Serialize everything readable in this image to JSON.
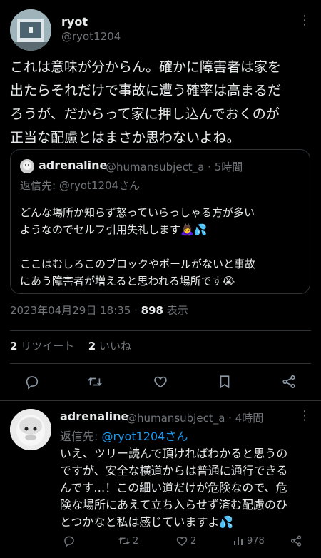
{
  "main_post": {
    "display_name": "ryot",
    "handle": "@ryot1204",
    "body_lines": [
      "これは意味が分からん。確かに障害者は家を",
      "出たらそれだけで事故に遭う確率は高まるだ",
      "ろうが、だからって家に押し込んでおくのが",
      "正当な配慮とはまさか思わないよね。"
    ],
    "quoted": {
      "display_name": "adrenaline",
      "handle_time": "@humansubject_a · 5時間",
      "reply_to": "返信先: @ryot1204さん",
      "body_lines": [
        "どんな場所か知らず怒っていらっしゃる方が多い",
        "ようなのでセルフ引用失礼します🙇‍♀️💦",
        "",
        "ここはむしろこのブロックやポールがないと事故",
        "にあう障害者が増えると思われる場所です😭"
      ]
    },
    "timestamp": "2023年04月29日 18:35 · ",
    "views_count": "898",
    "views_label": " 表示",
    "retweets_count": "2",
    "retweets_label": "リツイート",
    "likes_count": "2",
    "likes_label": "いいね"
  },
  "action_bar": {
    "icons": [
      "reply-icon",
      "retweet-icon",
      "like-icon",
      "bookmark-icon",
      "share-icon"
    ]
  },
  "reply": {
    "display_name": "adrenaline",
    "handle_time": "@humansubject_a · 4時間",
    "reply_prefix": "返信先: ",
    "reply_user": "@ryot1204さん",
    "body_lines": [
      "いえ、ツリー読んで頂ければわかると思うの",
      "ですが、安全な横道からは普通に通行できる",
      "んです…！この細い道だけが危険なので、危",
      "険な場所にあえて立ち入らせず済む配慮のひ",
      "とつかなと私は感じていますよ💦"
    ],
    "retweets": "2",
    "likes": "2",
    "views": "978"
  },
  "colors": {
    "background": "#000000",
    "text": "#e7e9ea",
    "muted": "#71767b",
    "accent": "#1d9bf0",
    "border": "#2f3336"
  }
}
